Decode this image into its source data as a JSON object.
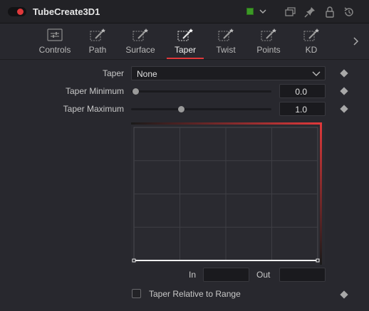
{
  "header": {
    "title": "TubeCreate3D1",
    "node_color": "#3c9a26",
    "icons": [
      "color-chevron-icon",
      "window-restore-icon",
      "pin-icon",
      "lock-icon",
      "reset-icon"
    ]
  },
  "tabs": [
    {
      "label": "Controls",
      "icon": "controls-sliders-icon"
    },
    {
      "label": "Path",
      "icon": "path-wand-icon"
    },
    {
      "label": "Surface",
      "icon": "surface-wand-icon"
    },
    {
      "label": "Taper",
      "icon": "taper-wand-icon",
      "active": true
    },
    {
      "label": "Twist",
      "icon": "twist-wand-icon"
    },
    {
      "label": "Points",
      "icon": "points-wand-icon"
    },
    {
      "label": "KD",
      "icon": "kd-wand-icon"
    }
  ],
  "taper": {
    "label": "Taper",
    "value": "None"
  },
  "taper_minimum": {
    "label": "Taper Minimum",
    "value": "0.0",
    "slider_level": 0.0
  },
  "taper_maximum": {
    "label": "Taper Maximum",
    "value": "1.0",
    "slider_level": 0.34
  },
  "curve": {
    "in_label": "In",
    "out_label": "Out",
    "in_value": "",
    "out_value": "",
    "curve_color": "#e0393b"
  },
  "taper_relative": {
    "label": "Taper Relative to Range",
    "checked": false
  }
}
